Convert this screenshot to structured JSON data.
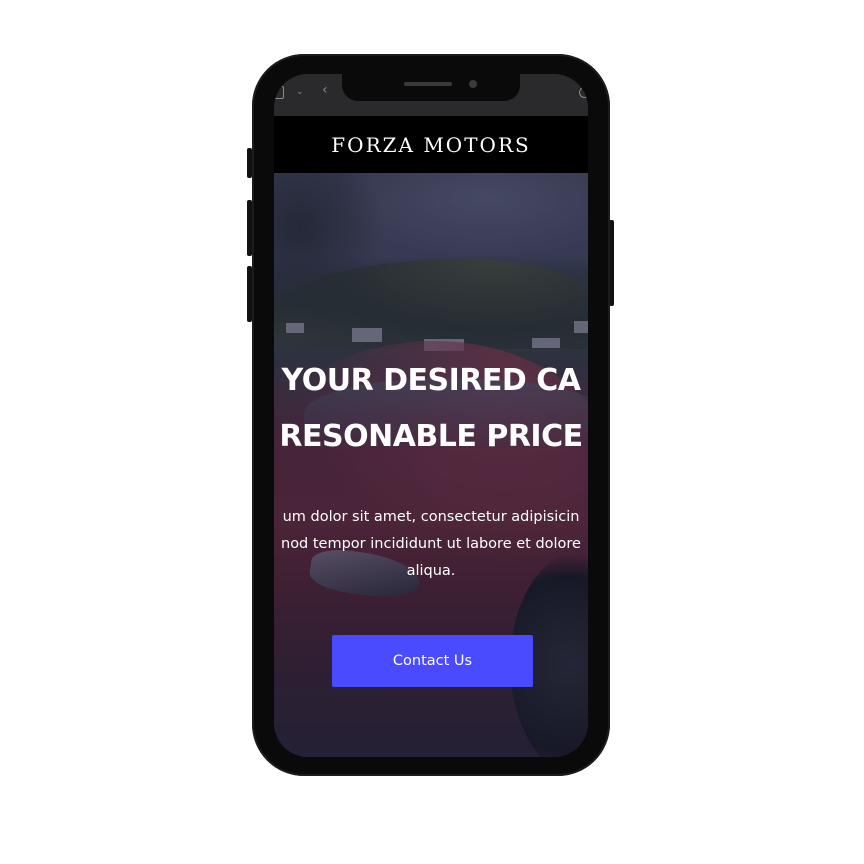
{
  "brand": {
    "name": "FORZA MOTORS"
  },
  "hero": {
    "title_line1": "YOUR DESIRED CA",
    "title_line2": "RESONABLE PRICE",
    "text_line1": "um dolor sit amet, consectetur adipisicin",
    "text_line2": "nod tempor incididunt ut labore et dolore",
    "text_line3": "aliqua.",
    "cta_label": "Contact Us"
  },
  "browser": {
    "icons": [
      "tabs-icon",
      "chevron-down-icon",
      "back-icon",
      "refresh-icon"
    ]
  },
  "colors": {
    "header_bg": "#000000",
    "cta_bg": "#4a4aff",
    "text": "#ffffff",
    "phone_frame": "#0a0a0a"
  }
}
